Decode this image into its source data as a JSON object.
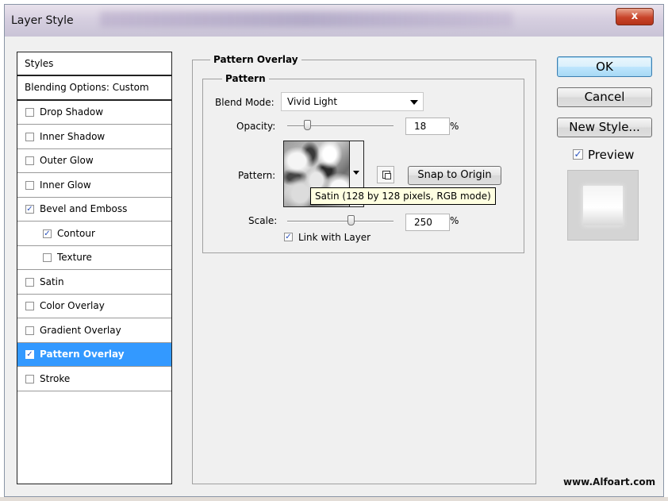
{
  "window": {
    "title": "Layer Style",
    "close_label": "x"
  },
  "styles_list": {
    "header": "Styles",
    "blending_options": "Blending Options: Custom",
    "items": [
      {
        "label": "Drop Shadow",
        "checked": false,
        "sub": false,
        "selected": false
      },
      {
        "label": "Inner Shadow",
        "checked": false,
        "sub": false,
        "selected": false
      },
      {
        "label": "Outer Glow",
        "checked": false,
        "sub": false,
        "selected": false
      },
      {
        "label": "Inner Glow",
        "checked": false,
        "sub": false,
        "selected": false
      },
      {
        "label": "Bevel and Emboss",
        "checked": true,
        "sub": false,
        "selected": false
      },
      {
        "label": "Contour",
        "checked": true,
        "sub": true,
        "selected": false
      },
      {
        "label": "Texture",
        "checked": false,
        "sub": true,
        "selected": false
      },
      {
        "label": "Satin",
        "checked": false,
        "sub": false,
        "selected": false
      },
      {
        "label": "Color Overlay",
        "checked": false,
        "sub": false,
        "selected": false
      },
      {
        "label": "Gradient Overlay",
        "checked": false,
        "sub": false,
        "selected": false
      },
      {
        "label": "Pattern Overlay",
        "checked": true,
        "sub": false,
        "selected": true
      },
      {
        "label": "Stroke",
        "checked": false,
        "sub": false,
        "selected": false
      }
    ]
  },
  "pattern_overlay": {
    "group_title": "Pattern Overlay",
    "subgroup_title": "Pattern",
    "blend_mode_label": "Blend Mode:",
    "blend_mode_value": "Vivid Light",
    "opacity_label": "Opacity:",
    "opacity_value": "18",
    "opacity_unit": "%",
    "pattern_label": "Pattern:",
    "pattern_tooltip": "Satin (128 by 128 pixels, RGB mode)",
    "snap_button": "Snap to Origin",
    "scale_label": "Scale:",
    "scale_value": "250",
    "scale_unit": "%",
    "link_label": "Link with Layer",
    "link_checked": true
  },
  "actions": {
    "ok": "OK",
    "cancel": "Cancel",
    "new_style": "New Style...",
    "preview_label": "Preview",
    "preview_checked": true
  },
  "watermark": "www.Alfoart.com",
  "colors": {
    "selection": "#3399ff",
    "tooltip_bg": "#ffffe1",
    "check": "#2a52be"
  }
}
